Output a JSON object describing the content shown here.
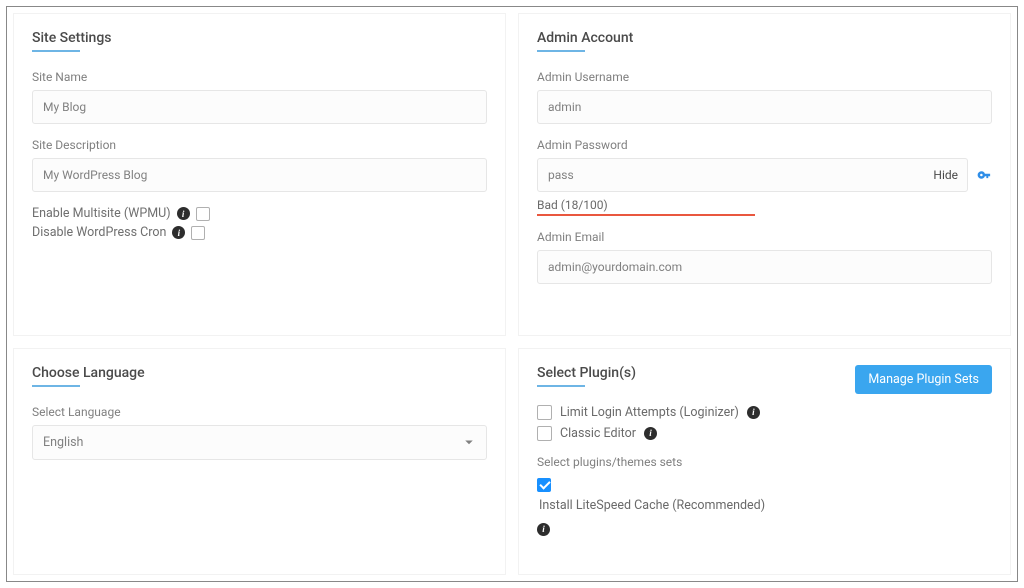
{
  "site_settings": {
    "title": "Site Settings",
    "site_name_label": "Site Name",
    "site_name_value": "My Blog",
    "site_description_label": "Site Description",
    "site_description_value": "My WordPress Blog",
    "enable_multisite_label": "Enable Multisite (WPMU)",
    "disable_cron_label": "Disable WordPress Cron"
  },
  "admin_account": {
    "title": "Admin Account",
    "username_label": "Admin Username",
    "username_value": "admin",
    "password_label": "Admin Password",
    "password_value": "pass",
    "hide_text": "Hide",
    "strength_text": "Bad (18/100)",
    "email_label": "Admin Email",
    "email_value": "admin@yourdomain.com"
  },
  "language": {
    "title": "Choose Language",
    "select_label": "Select Language",
    "selected": "English",
    "options": [
      "English"
    ]
  },
  "plugins": {
    "title": "Select Plugin(s)",
    "manage_button": "Manage Plugin Sets",
    "items": [
      {
        "label": "Limit Login Attempts (Loginizer)",
        "checked": false
      },
      {
        "label": "Classic Editor",
        "checked": false
      }
    ],
    "sets_label": "Select plugins/themes sets",
    "recommend_label": "Install LiteSpeed Cache (Recommended)",
    "recommend_checked": true
  }
}
